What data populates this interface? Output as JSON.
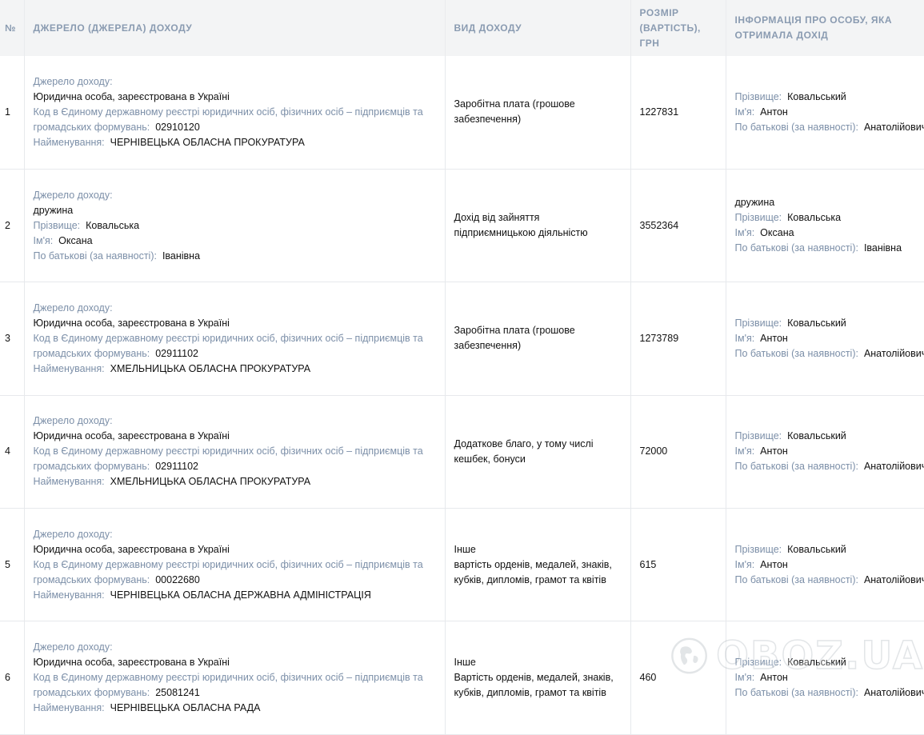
{
  "header": {
    "num": "№",
    "source": "ДЖЕРЕЛО (ДЖЕРЕЛА) ДОХОДУ",
    "type": "ВИД ДОХОДУ",
    "amount_l1": "РОЗМІР",
    "amount_l2": "(ВАРТІСТЬ),",
    "amount_l3": "ГРН",
    "person_l1": "ІНФОРМАЦІЯ ПРО ОСОБУ, ЯКА",
    "person_l2": "ОТРИМАЛА ДОХІД"
  },
  "labels": {
    "source": "Джерело доходу:",
    "code": "Код в Єдиному державному реєстрі юридичних осіб, фізичних осіб – підприємців та громадських формувань:",
    "name": "Найменування:",
    "surname": "Прізвище:",
    "first_name": "Ім'я:",
    "patronymic": "По батькові (за наявності):"
  },
  "rows": [
    {
      "num": "1",
      "src_kind": "Юридична особа, зареєстрована в Україні",
      "code": "02910120",
      "org": "ЧЕРНІВЕЦЬКА ОБЛАСНА ПРОКУРАТУРА",
      "type_l1": "Заробітна плата (грошове",
      "type_l2": "забезпечення)",
      "amount": "1227831",
      "surname": "Ковальський",
      "first_name": "Антон",
      "patronymic": "Анатолійович"
    },
    {
      "num": "2",
      "src_kind": "дружина",
      "src_surname": "Ковальська",
      "src_first_name": "Оксана",
      "src_patronymic": "Іванівна",
      "type_l1": "Дохід від зайняття",
      "type_l2": "підприємницькою діяльністю",
      "amount": "3552364",
      "relation": "дружина",
      "surname": "Ковальська",
      "first_name": "Оксана",
      "patronymic": "Іванівна"
    },
    {
      "num": "3",
      "src_kind": "Юридична особа, зареєстрована в Україні",
      "code": "02911102",
      "org": "ХМЕЛЬНИЦЬКА ОБЛАСНА ПРОКУРАТУРА",
      "type_l1": "Заробітна плата (грошове",
      "type_l2": "забезпечення)",
      "amount": "1273789",
      "surname": "Ковальський",
      "first_name": "Антон",
      "patronymic": "Анатолійович"
    },
    {
      "num": "4",
      "src_kind": "Юридична особа, зареєстрована в Україні",
      "code": "02911102",
      "org": "ХМЕЛЬНИЦЬКА ОБЛАСНА ПРОКУРАТУРА",
      "type_l1": "Додаткове благо, у тому числі",
      "type_l2": "кешбек, бонуси",
      "amount": "72000",
      "surname": "Ковальський",
      "first_name": "Антон",
      "patronymic": "Анатолійович"
    },
    {
      "num": "5",
      "src_kind": "Юридична особа, зареєстрована в Україні",
      "code": "00022680",
      "org": "ЧЕРНІВЕЦЬКА ОБЛАСНА ДЕРЖАВНА АДМІНІСТРАЦІЯ",
      "type_l1": "Інше",
      "type_l2": "вартість орденів, медалей, знаків,",
      "type_l3": "кубків, дипломів, грамот та квітів",
      "amount": "615",
      "surname": "Ковальський",
      "first_name": "Антон",
      "patronymic": "Анатолійович"
    },
    {
      "num": "6",
      "src_kind": "Юридична особа, зареєстрована в Україні",
      "code": "25081241",
      "org": "ЧЕРНІВЕЦЬКА ОБЛАСНА РАДА",
      "type_l1": "Інше",
      "type_l2": "Вартість орденів, медалей, знаків,",
      "type_l3": "кубків, дипломів, грамот та квітів",
      "amount": "460",
      "surname": "Ковальський",
      "first_name": "Антон",
      "patronymic": "Анатолійович"
    }
  ],
  "watermark": {
    "text": "OBOZ.UA",
    "icon": "globe-icon"
  }
}
